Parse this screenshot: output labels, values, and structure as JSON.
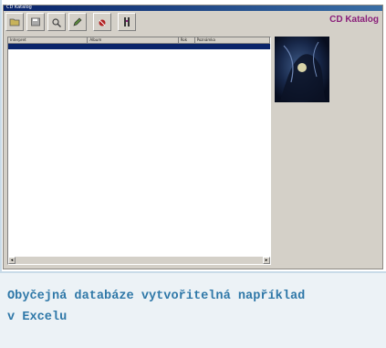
{
  "window": {
    "title_bar_text": "CD Katalog",
    "app_title": "CD Katalog"
  },
  "toolbar": {
    "buttons": [
      {
        "icon": "open-folder-icon"
      },
      {
        "icon": "save-icon"
      },
      {
        "icon": "search-icon"
      },
      {
        "icon": "edit-icon"
      },
      {
        "icon": "delete-icon"
      },
      {
        "icon": "info-icon"
      }
    ]
  },
  "list": {
    "columns": [
      "Interpret",
      "Album",
      "Rok",
      "Poznámka"
    ],
    "rows": [
      [
        "",
        "",
        "",
        ""
      ]
    ]
  },
  "caption": {
    "line1": "Obyčejná databáze vytvořitelná například",
    "line2": "v Excelu"
  },
  "colors": {
    "accent": "#8a1f7a",
    "caption": "#2f78a8",
    "selection": "#0a246a"
  }
}
